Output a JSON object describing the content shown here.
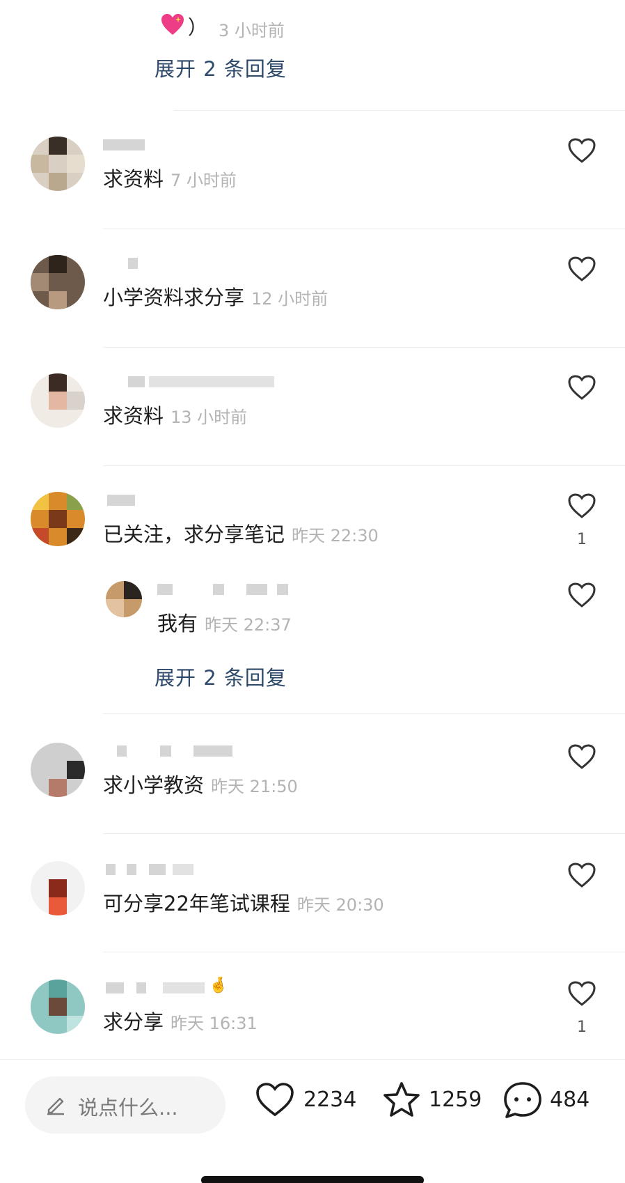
{
  "top_reply": {
    "paren": "）",
    "time": "3 小时前",
    "expand_label": "展开 2 条回复",
    "emoji_icon": "sparkling-heart-icon"
  },
  "comments": [
    {
      "text": "求资料",
      "time": "7 小时前",
      "likes": ""
    },
    {
      "text": "小学资料求分享",
      "time": "12 小时前",
      "likes": ""
    },
    {
      "text": "求资料",
      "time": "13 小时前",
      "likes": ""
    },
    {
      "text": "已关注，求分享笔记",
      "time": "昨天 22:30",
      "likes": "1",
      "reply": {
        "text": "我有",
        "time": "昨天 22:37"
      },
      "expand_label": "展开 2 条回复"
    },
    {
      "text": "求小学教资",
      "time": "昨天 21:50",
      "likes": ""
    },
    {
      "text": "可分享22年笔试课程",
      "time": "昨天 20:30",
      "likes": ""
    },
    {
      "text": "求分享",
      "time": "昨天 16:31",
      "likes": "1"
    }
  ],
  "bottom_bar": {
    "input_placeholder": "说点什么...",
    "likes": "2234",
    "favorites": "1259",
    "comments": "484",
    "icons": [
      "pencil-icon",
      "heart-icon",
      "star-icon",
      "comment-bubble-icon"
    ]
  },
  "colors": {
    "expand_link": "#2e4a6b",
    "time_text": "#b3b3b3",
    "divider": "#ececec"
  }
}
